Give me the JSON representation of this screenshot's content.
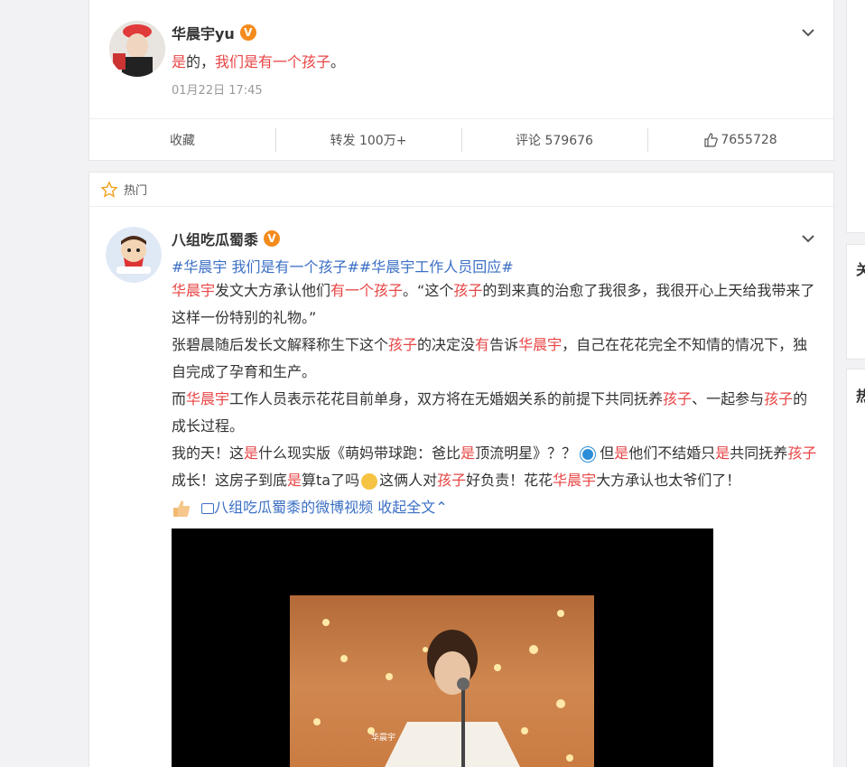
{
  "post1": {
    "username": "华晨宇yu",
    "content_red": "是",
    "content_mid": "的，",
    "content_red2": "我们是有一个孩子",
    "content_end": "。",
    "time": "01月22日 17:45",
    "actions": {
      "favorite": "收藏",
      "repost": "转发 100万+",
      "comment": "评论 579676",
      "like": "7655728"
    }
  },
  "hot": {
    "label": "热门"
  },
  "post2": {
    "username": "八组吃瓜蜀黍",
    "topics": "#华晨宇 我们是有一个孩子##华晨宇工作人员回应#",
    "line1_a": "华晨宇",
    "line1_b": "发文大方承认他们",
    "line1_c": "有一个孩子",
    "line1_d": "。“这个",
    "line1_e": "孩子",
    "line1_f": "的到来真的治愈了我很多，我很开心上天给我带来了这样一份特别的礼物。”",
    "line2_a": "张碧晨随后发长文解释称生下这个",
    "line2_b": "孩子",
    "line2_c": "的决定没",
    "line2_d": "有",
    "line2_e": "告诉",
    "line2_f": "华晨宇",
    "line2_g": "，自己在花花完全不知情的情况下，独自完成了孕育和生产。",
    "line3_a": "而",
    "line3_b": "华晨宇",
    "line3_c": "工作人员表示花花目前单身，双方将在无婚姻关系的前提下共同抚养",
    "line3_d": "孩子",
    "line3_e": "、一起参与",
    "line3_f": "孩子",
    "line3_g": "的成长过程。",
    "line4_a": "我的天！这",
    "line4_b": "是",
    "line4_c": "什么现实版《萌妈带球跑：爸比",
    "line4_d": "是",
    "line4_e": "顶流明星》？？ ",
    "line4_f": " 但",
    "line4_g": "是",
    "line4_h": "他们不结婚只",
    "line4_i": "是",
    "line4_j": "共同抚养",
    "line4_k": "孩子",
    "line4_l": "成长！这房子到底",
    "line4_m": "是",
    "line4_n": "算ta了吗",
    "line4_o": "这俩人对",
    "line4_p": "孩子",
    "line4_q": "好负责！花花",
    "line4_r": "华晨宇",
    "line4_s": "大方承认也太爷们了！",
    "video_link": "八组吃瓜蜀黍的微博视频",
    "collapse": "收起全文",
    "video_watermark": "华晨宇"
  },
  "right_panel": {
    "c1": "关",
    "c2": "热"
  },
  "colors": {
    "highlight": "#e84545",
    "link": "#3b6fc4",
    "verified": "#f38b1d"
  }
}
